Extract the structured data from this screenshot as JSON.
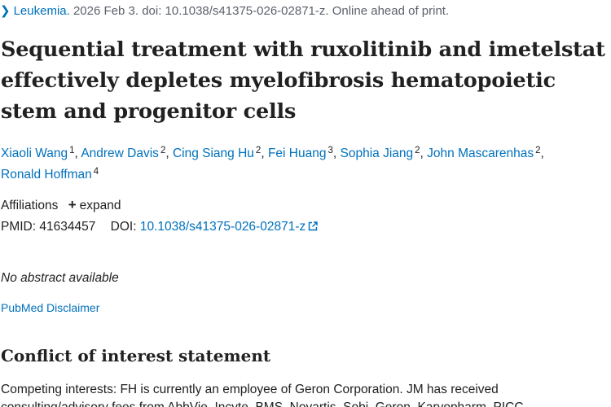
{
  "citation": {
    "journal": "Leukemia.",
    "details": " 2026 Feb 3. doi: 10.1038/s41375-026-02871-z. Online ahead of print."
  },
  "title": "Sequential treatment with ruxolitinib and imetelstat effectively depletes myelofibrosis hematopoietic stem and progenitor cells",
  "authors": [
    {
      "name": "Xiaoli Wang",
      "sup": "1"
    },
    {
      "name": "Andrew Davis",
      "sup": "2"
    },
    {
      "name": "Cing Siang Hu",
      "sup": "2"
    },
    {
      "name": "Fei Huang",
      "sup": "3"
    },
    {
      "name": "Sophia Jiang",
      "sup": "2"
    },
    {
      "name": "John Mascarenhas",
      "sup": "2"
    },
    {
      "name": "Ronald Hoffman",
      "sup": "4"
    }
  ],
  "affiliations": {
    "label": "Affiliations",
    "toggle_label": "expand"
  },
  "ids": {
    "pmid_label": "PMID:",
    "pmid": "41634457",
    "doi_label": "DOI:",
    "doi": "10.1038/s41375-026-02871-z"
  },
  "no_abstract": "No abstract available",
  "disclaimer": "PubMed Disclaimer",
  "coi": {
    "heading": "Conflict of interest statement",
    "text": "Competing interests: FH is currently an employee of Geron Corporation. JM has received consulting/advisory fees from AbbVie, Incyte, BMS, Novartis, Sobi, Geron, Karyopharm, PICC"
  }
}
